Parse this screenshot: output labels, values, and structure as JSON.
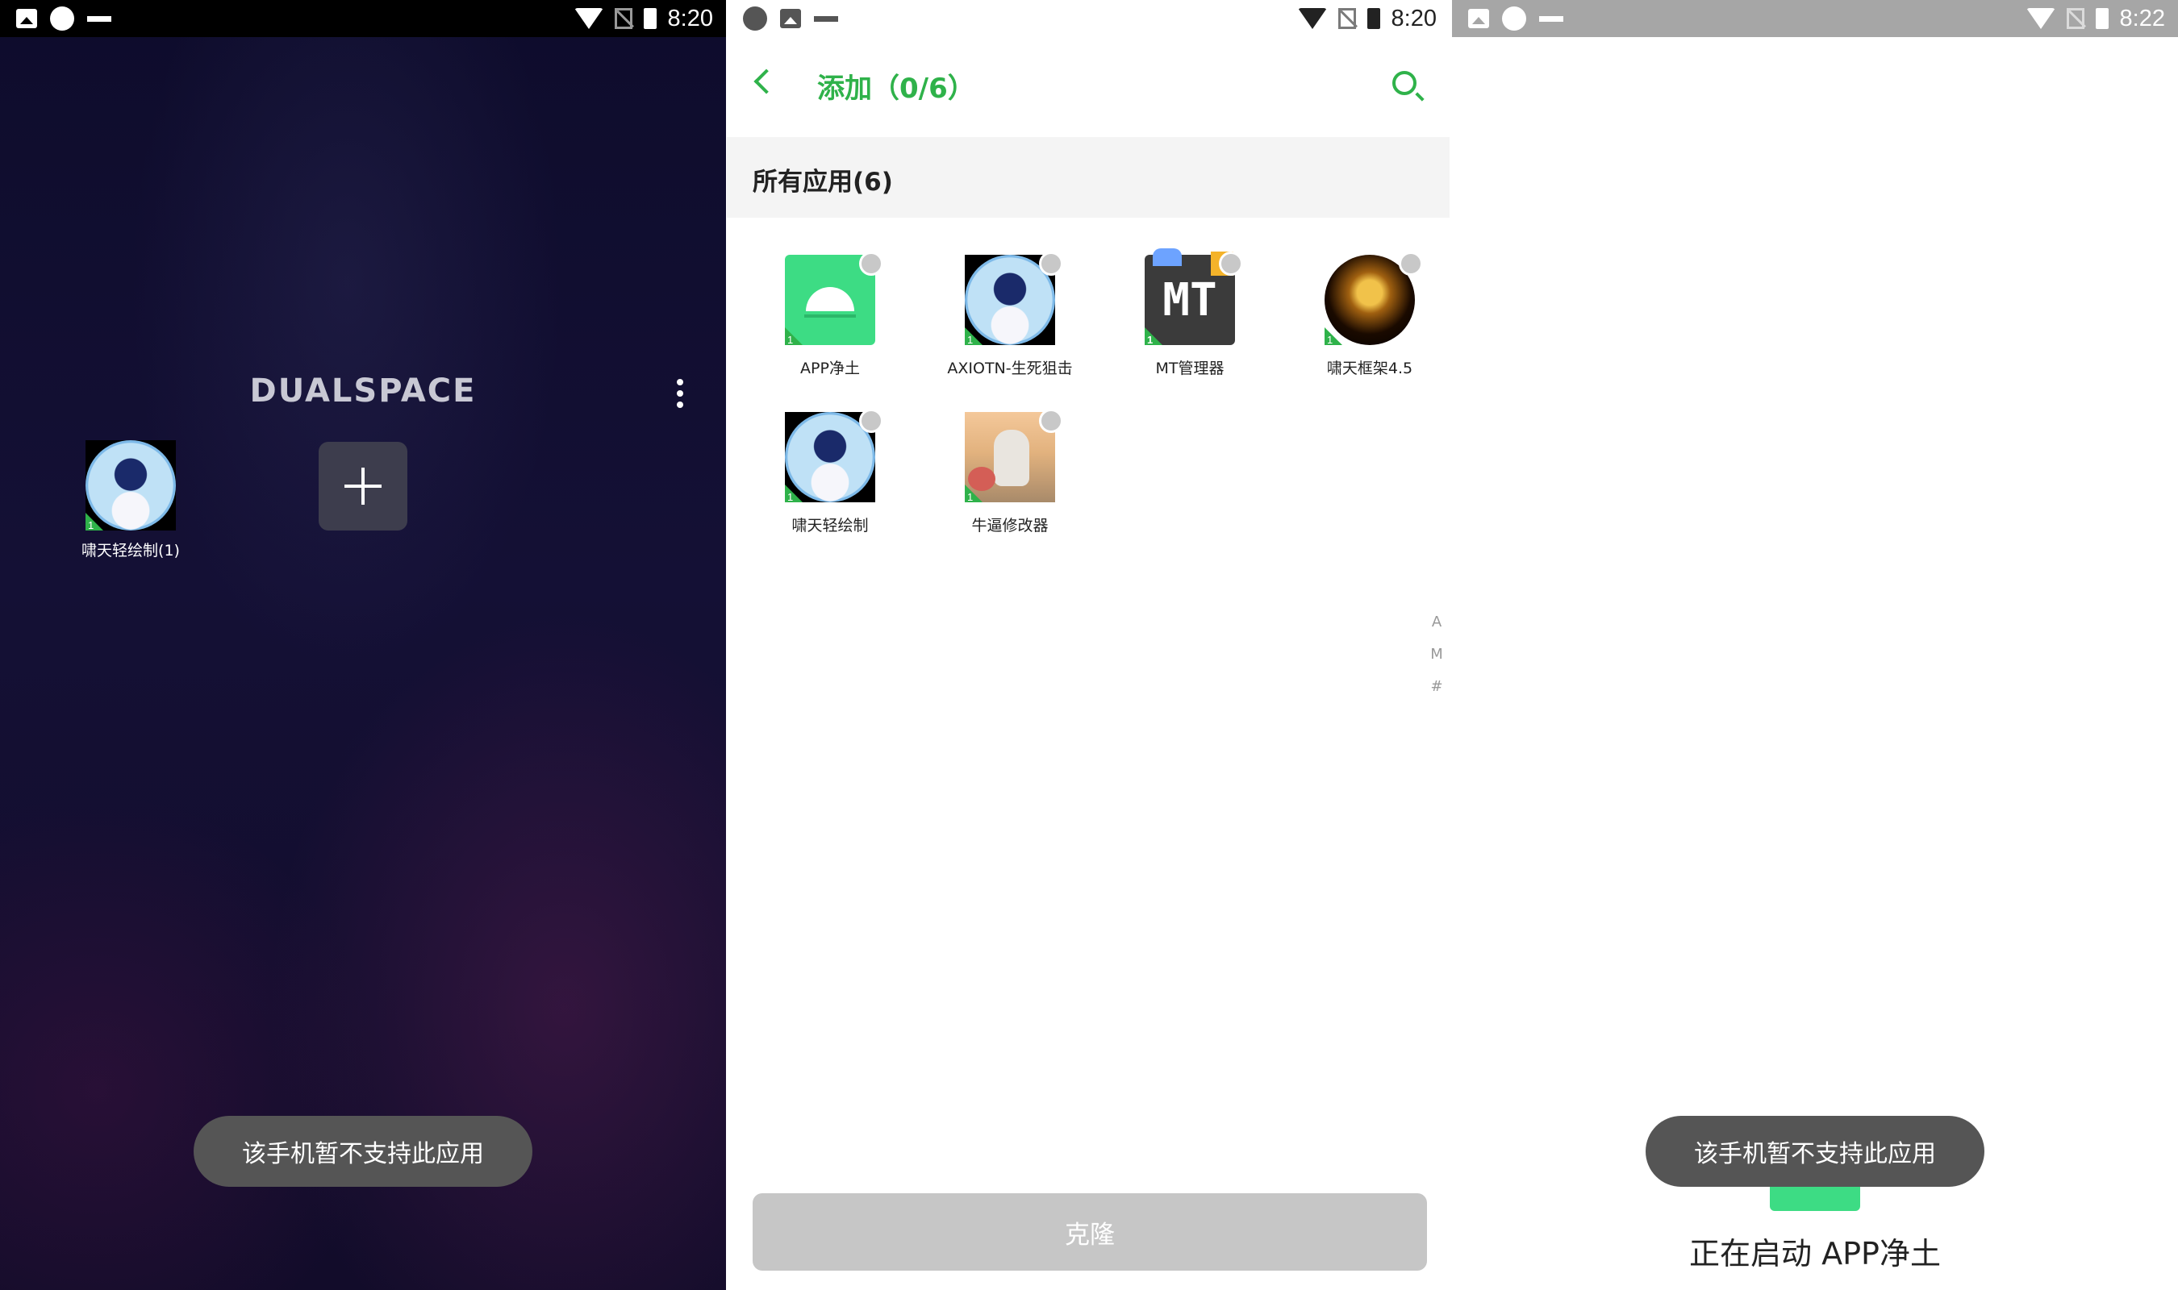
{
  "panel1": {
    "status_time": "8:20",
    "logo_text": "DUALSPACE",
    "home_app_label": "啸天轻绘制(1)",
    "toast": "该手机暂不支持此应用"
  },
  "panel2": {
    "status_time": "8:20",
    "title": "添加（0/6）",
    "section_title": "所有应用(6)",
    "apps": [
      {
        "label": "APP净土",
        "icon": "android-icon"
      },
      {
        "label": "AXIOTN-生死狙击",
        "icon": "avatar-icon"
      },
      {
        "label": "MT管理器",
        "icon": "mt-icon"
      },
      {
        "label": "啸天框架4.5",
        "icon": "frame-icon"
      },
      {
        "label": "啸天轻绘制",
        "icon": "avatar-icon"
      },
      {
        "label": "牛逼修改器",
        "icon": "astronaut-icon"
      }
    ],
    "index_letters": [
      "A",
      "M",
      "#"
    ],
    "clone_button": "克隆"
  },
  "panel3": {
    "status_time": "8:22",
    "toast": "该手机暂不支持此应用",
    "launching_text": "正在启动 APP净土"
  },
  "colors": {
    "accent_green": "#2fb24a",
    "toast_bg": "#555555",
    "disabled_button": "#c6c6c6"
  }
}
